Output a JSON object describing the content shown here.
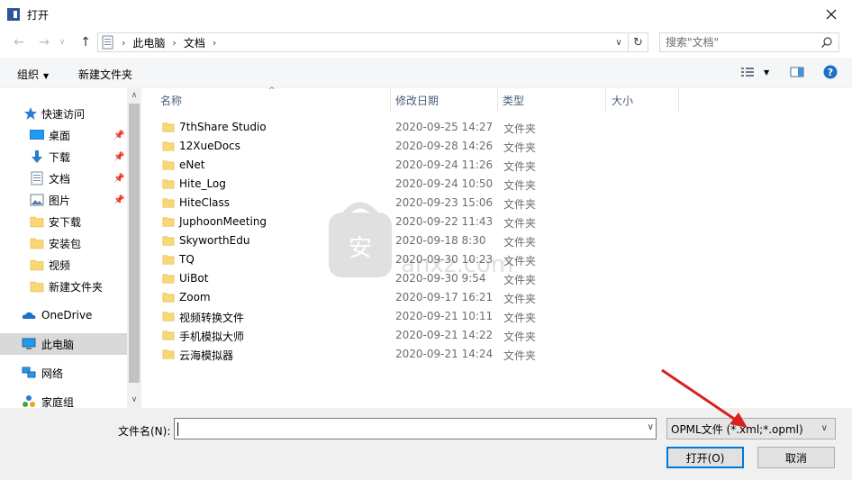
{
  "window": {
    "title": "打开"
  },
  "address": {
    "crumbs": [
      "此电脑",
      "文档"
    ]
  },
  "search": {
    "placeholder": "搜索\"文档\""
  },
  "toolbar": {
    "organize": "组织",
    "new_folder": "新建文件夹"
  },
  "nav": {
    "items": [
      {
        "label": "快速访问",
        "icon": "star-icon"
      },
      {
        "label": "桌面",
        "icon": "desktop-icon",
        "pinned": true
      },
      {
        "label": "下载",
        "icon": "download-icon",
        "pinned": true
      },
      {
        "label": "文档",
        "icon": "document-icon",
        "pinned": true
      },
      {
        "label": "图片",
        "icon": "picture-icon",
        "pinned": true
      },
      {
        "label": "安下载",
        "icon": "folder-icon"
      },
      {
        "label": "安装包",
        "icon": "folder-icon"
      },
      {
        "label": "视频",
        "icon": "folder-icon"
      },
      {
        "label": "新建文件夹",
        "icon": "folder-icon"
      },
      {
        "label": "OneDrive",
        "icon": "cloud-icon"
      },
      {
        "label": "此电脑",
        "icon": "computer-icon",
        "selected": true
      },
      {
        "label": "网络",
        "icon": "network-icon"
      },
      {
        "label": "家庭组",
        "icon": "homegroup-icon"
      }
    ]
  },
  "columns": {
    "name": "名称",
    "date": "修改日期",
    "type": "类型",
    "size": "大小"
  },
  "files": [
    {
      "name": "7thShare Studio",
      "date": "2020-09-25 14:27",
      "type": "文件夹"
    },
    {
      "name": "12XueDocs",
      "date": "2020-09-28 14:26",
      "type": "文件夹"
    },
    {
      "name": "eNet",
      "date": "2020-09-24 11:26",
      "type": "文件夹"
    },
    {
      "name": "Hite_Log",
      "date": "2020-09-24 10:50",
      "type": "文件夹"
    },
    {
      "name": "HiteClass",
      "date": "2020-09-23 15:06",
      "type": "文件夹"
    },
    {
      "name": "JuphoonMeeting",
      "date": "2020-09-22 11:43",
      "type": "文件夹"
    },
    {
      "name": "SkyworthEdu",
      "date": "2020-09-18 8:30",
      "type": "文件夹"
    },
    {
      "name": "TQ",
      "date": "2020-09-30 10:23",
      "type": "文件夹"
    },
    {
      "name": "UiBot",
      "date": "2020-09-30 9:54",
      "type": "文件夹"
    },
    {
      "name": "Zoom",
      "date": "2020-09-17 16:21",
      "type": "文件夹"
    },
    {
      "name": "视频转换文件",
      "date": "2020-09-21 10:11",
      "type": "文件夹"
    },
    {
      "name": "手机模拟大师",
      "date": "2020-09-21 14:22",
      "type": "文件夹"
    },
    {
      "name": "云海模拟器",
      "date": "2020-09-21 14:24",
      "type": "文件夹"
    }
  ],
  "watermark": {
    "text": "anxz.com"
  },
  "bottom": {
    "filename_label": "文件名(N):",
    "filename_value": "",
    "filetype": "OPML文件 (*.xml;*.opml)",
    "open": "打开(O)",
    "cancel": "取消"
  },
  "colors": {
    "accent": "#0078d7",
    "folder": "#f8d775",
    "arrow": "#d9201f"
  }
}
